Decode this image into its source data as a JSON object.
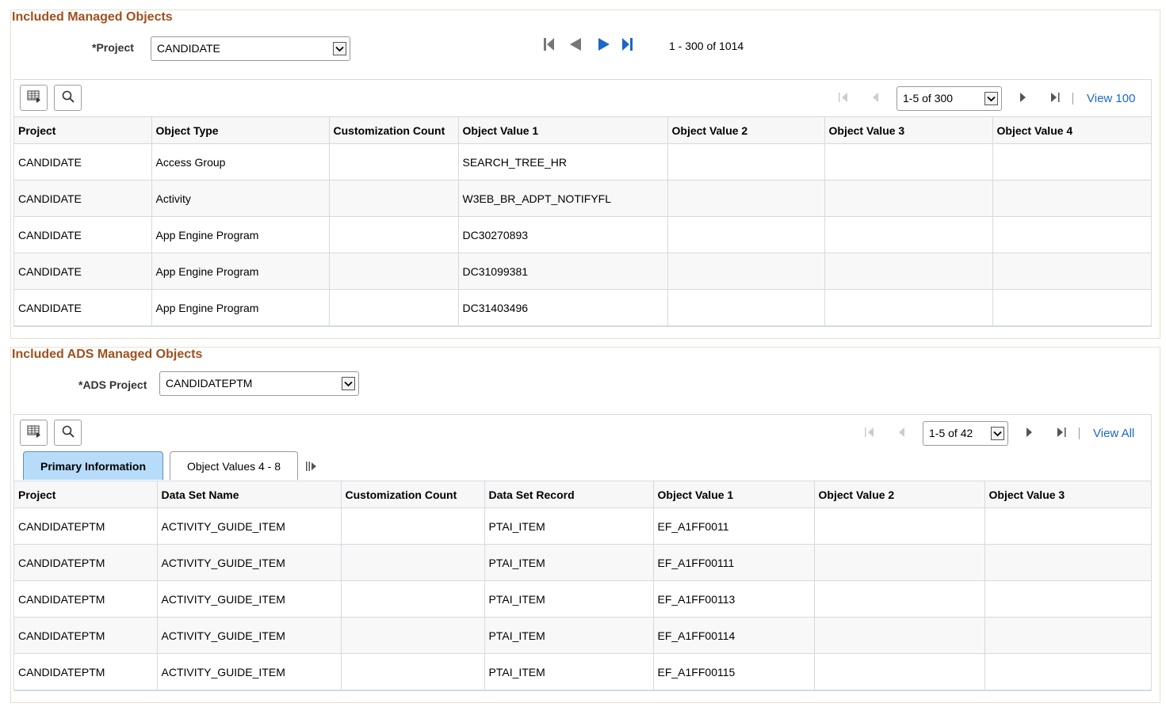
{
  "section1": {
    "title": "Included Managed Objects",
    "project_label": "*Project",
    "project_value": "CANDIDATE",
    "nav": {
      "first_icon": "first-page-icon",
      "prev_icon": "previous-page-icon",
      "next_icon": "next-page-icon",
      "last_icon": "last-page-icon",
      "range": "1 - 300 of 1014"
    },
    "grid": {
      "toolbar": {
        "personalize_icon": "grid-personalize-icon",
        "find_icon": "search-icon"
      },
      "pager": {
        "range_value": "1-5 of 300",
        "view_link": "View 100"
      },
      "columns": [
        "Project",
        "Object Type",
        "Customization Count",
        "Object Value 1",
        "Object Value 2",
        "Object Value 3",
        "Object Value 4"
      ],
      "rows": [
        [
          "CANDIDATE",
          "Access Group",
          "",
          "SEARCH_TREE_HR",
          "",
          "",
          ""
        ],
        [
          "CANDIDATE",
          "Activity",
          "",
          "W3EB_BR_ADPT_NOTIFYFL",
          "",
          "",
          ""
        ],
        [
          "CANDIDATE",
          "App Engine Program",
          "",
          "DC30270893",
          "",
          "",
          ""
        ],
        [
          "CANDIDATE",
          "App Engine Program",
          "",
          "DC31099381",
          "",
          "",
          ""
        ],
        [
          "CANDIDATE",
          "App Engine Program",
          "",
          "DC31403496",
          "",
          "",
          ""
        ]
      ]
    }
  },
  "section2": {
    "title": "Included ADS Managed Objects",
    "project_label": "*ADS Project",
    "project_value": "CANDIDATEPTM",
    "grid": {
      "toolbar": {
        "personalize_icon": "grid-personalize-icon",
        "find_icon": "search-icon"
      },
      "pager": {
        "range_value": "1-5 of 42",
        "view_link": "View All"
      },
      "tabs": [
        {
          "label": "Primary Information",
          "active": true
        },
        {
          "label": "Object Values 4 - 8",
          "active": false
        }
      ],
      "show_all_columns_icon": "show-all-columns-icon",
      "columns": [
        "Project",
        "Data Set Name",
        "Customization Count",
        "Data Set Record",
        "Object Value 1",
        "Object Value 2",
        "Object Value 3"
      ],
      "rows": [
        [
          "CANDIDATEPTM",
          "ACTIVITY_GUIDE_ITEM",
          "",
          "PTAI_ITEM",
          "EF_A1FF0011",
          "",
          ""
        ],
        [
          "CANDIDATEPTM",
          "ACTIVITY_GUIDE_ITEM",
          "",
          "PTAI_ITEM",
          "EF_A1FF00111",
          "",
          ""
        ],
        [
          "CANDIDATEPTM",
          "ACTIVITY_GUIDE_ITEM",
          "",
          "PTAI_ITEM",
          "EF_A1FF00113",
          "",
          ""
        ],
        [
          "CANDIDATEPTM",
          "ACTIVITY_GUIDE_ITEM",
          "",
          "PTAI_ITEM",
          "EF_A1FF00114",
          "",
          ""
        ],
        [
          "CANDIDATEPTM",
          "ACTIVITY_GUIDE_ITEM",
          "",
          "PTAI_ITEM",
          "EF_A1FF00115",
          "",
          ""
        ]
      ]
    }
  },
  "colors": {
    "section_title": "#a0501e",
    "link": "#1a68c8",
    "active_tab": "#b7dcf9",
    "nav_active": "#1a68c8",
    "nav_disabled": "#777777"
  }
}
